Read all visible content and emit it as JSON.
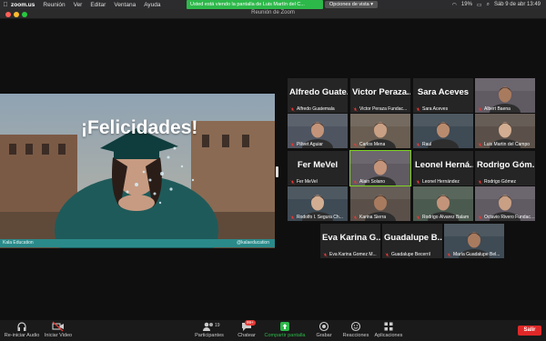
{
  "menubar": {
    "app": "zoom.us",
    "items": [
      "Reunión",
      "Ver",
      "Editar",
      "Ventana",
      "Ayuda"
    ],
    "share_banner": "Usted está viendo la pantalla de Luis Martín del C...",
    "view_options": "Opciones de vista",
    "battery": "19%",
    "clock": "Sáb 9 de abr  13:49"
  },
  "window": {
    "title": "Reunión de Zoom"
  },
  "shared_screen": {
    "slide_title": "¡Felicidades!",
    "caption_left": "Kala Education",
    "caption_right": "@kalaeducation"
  },
  "participants": [
    {
      "display": "Alfredo Guate...",
      "name": "Alfredo Guatemala",
      "video": false
    },
    {
      "display": "Victor Peraza...",
      "name": "Victor Peraza Fundac...",
      "video": false
    },
    {
      "display": "Sara Aceves",
      "name": "Sara Aceves",
      "video": false
    },
    {
      "display": "",
      "name": "Albert Baena",
      "video": true
    },
    {
      "display": "",
      "name": "Pilivet Aguiar",
      "video": true
    },
    {
      "display": "",
      "name": "Carlos Mena",
      "video": true
    },
    {
      "display": "",
      "name": "Raul",
      "video": true
    },
    {
      "display": "",
      "name": "Luis Martin del Campo",
      "video": true
    },
    {
      "display": "Fer MeVel",
      "name": "Fer MeVel",
      "video": false
    },
    {
      "display": "",
      "name": "Alain Solano",
      "video": true
    },
    {
      "display": "Leonel Herná...",
      "name": "Leonel Hernández",
      "video": false
    },
    {
      "display": "Rodrigo Góm...",
      "name": "Rodrigo Gómez",
      "video": false
    },
    {
      "display": "",
      "name": "Rodolfo I. Segura Ch...",
      "video": true
    },
    {
      "display": "",
      "name": "Karina Sierra",
      "video": true
    },
    {
      "display": "",
      "name": "Rodrigo Álvarez Balam",
      "video": true
    },
    {
      "display": "",
      "name": "Octavio Rivero Fundació...",
      "video": true
    },
    {
      "display": "Eva Karina G...",
      "name": "Eva Karina Gomez M...",
      "video": false
    },
    {
      "display": "Guadalupe B...",
      "name": "Guadalupe Becerril",
      "video": false
    },
    {
      "display": "",
      "name": "María Guadalupe Bel...",
      "video": true
    }
  ],
  "toolbar": {
    "audio": "Re-iniciar Audio",
    "video": "Iniciar Video",
    "participants": "Participantes",
    "participant_count": "19",
    "chat": "Chatear",
    "chat_badge": "99+",
    "share": "Compartir pantalla",
    "record": "Grabar",
    "reactions": "Reacciones",
    "apps": "Aplicaciones",
    "leave": "Salir"
  },
  "colors": {
    "active_speaker": "#7ed321",
    "share_green": "#2db84a",
    "leave_red": "#e02828"
  }
}
